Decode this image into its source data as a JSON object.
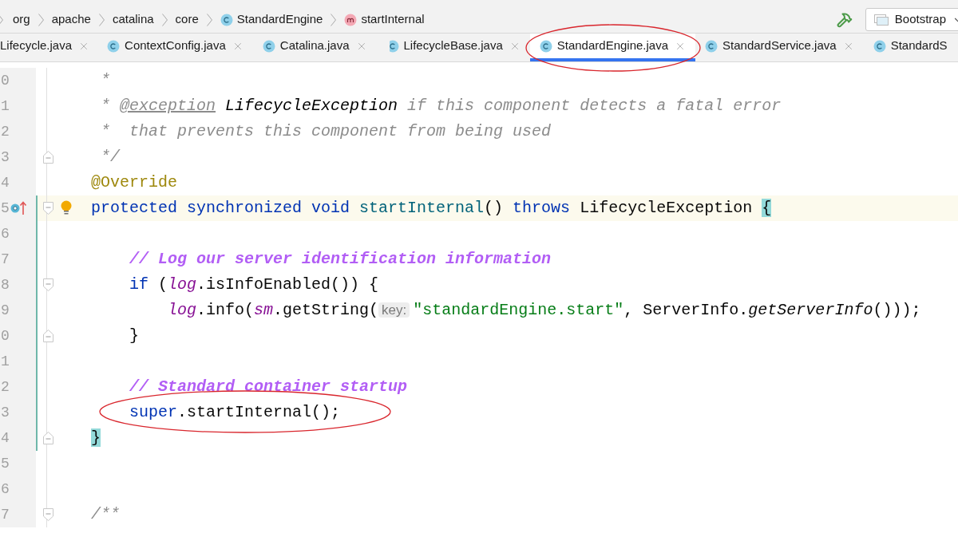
{
  "breadcrumb": {
    "items": [
      {
        "label": "org",
        "kind": "package"
      },
      {
        "label": "apache",
        "kind": "package"
      },
      {
        "label": "catalina",
        "kind": "package"
      },
      {
        "label": "core",
        "kind": "package"
      },
      {
        "label": "StandardEngine",
        "kind": "class"
      },
      {
        "label": "startInternal",
        "kind": "method"
      }
    ],
    "run_config": {
      "label": "Bootstrap"
    }
  },
  "tabs": [
    {
      "label": "Lifecycle.java",
      "kind": "none",
      "selected": false,
      "closable": true
    },
    {
      "label": "ContextConfig.java",
      "kind": "class",
      "selected": false,
      "closable": true
    },
    {
      "label": "Catalina.java",
      "kind": "class",
      "selected": false,
      "closable": true
    },
    {
      "label": "LifecycleBase.java",
      "kind": "abstract",
      "selected": false,
      "closable": true
    },
    {
      "label": "StandardEngine.java",
      "kind": "class",
      "selected": true,
      "closable": true
    },
    {
      "label": "StandardService.java",
      "kind": "class",
      "selected": false,
      "closable": true
    },
    {
      "label": "StandardS",
      "kind": "class",
      "selected": false,
      "closable": false
    }
  ],
  "editor": {
    "lines": [
      {
        "number": "0",
        "current": false,
        "modified": false,
        "intention": false,
        "segments": [
          {
            "text": " *",
            "kind": "doc"
          }
        ]
      },
      {
        "number": "1",
        "current": false,
        "modified": false,
        "intention": false,
        "segments": [
          {
            "text": " * ",
            "kind": "doc"
          },
          {
            "text": "@exception",
            "kind": "doc-tag"
          },
          {
            "text": " LifecycleException",
            "kind": "doc-ref"
          },
          {
            "text": " if this component detects a fatal error",
            "kind": "doc"
          }
        ]
      },
      {
        "number": "2",
        "current": false,
        "modified": false,
        "intention": false,
        "segments": [
          {
            "text": " *  that prevents this component from being used",
            "kind": "doc"
          }
        ]
      },
      {
        "number": "3",
        "current": false,
        "modified": false,
        "intention": false,
        "fold": {
          "kind": "end"
        },
        "segments": [
          {
            "text": " */",
            "kind": "doc"
          }
        ]
      },
      {
        "number": "4",
        "current": false,
        "modified": false,
        "intention": false,
        "segments": [
          {
            "text": "@Override",
            "kind": "annotation"
          }
        ]
      },
      {
        "number": "5",
        "current": true,
        "modified": true,
        "intention": true,
        "gutter_marker": {
          "kind": "override"
        },
        "fold": {
          "kind": "start"
        },
        "segments": [
          {
            "text": "protected synchronized void ",
            "kind": "keyword"
          },
          {
            "text": "startInternal",
            "kind": "method-decl"
          },
          {
            "text": "() ",
            "kind": "plain"
          },
          {
            "text": "throws ",
            "kind": "keyword"
          },
          {
            "text": "LifecycleException ",
            "kind": "plain"
          },
          {
            "text": "{",
            "kind": "matched-brace"
          }
        ]
      },
      {
        "number": "6",
        "current": false,
        "modified": true,
        "intention": false
      },
      {
        "number": "7",
        "current": false,
        "modified": true,
        "intention": false,
        "segments": [
          {
            "text": "    // Log our server identification information",
            "kind": "todo-comment"
          }
        ]
      },
      {
        "number": "8",
        "current": false,
        "modified": true,
        "intention": false,
        "fold": {
          "kind": "start"
        },
        "segments": [
          {
            "text": "    if ",
            "kind": "keyword"
          },
          {
            "text": "(",
            "kind": "plain"
          },
          {
            "text": "log",
            "kind": "field"
          },
          {
            "text": ".isInfoEnabled()) {",
            "kind": "plain"
          }
        ]
      },
      {
        "number": "9",
        "current": false,
        "modified": true,
        "intention": false,
        "segments": [
          {
            "text": "        log",
            "kind": "field"
          },
          {
            "text": ".info(",
            "kind": "plain"
          },
          {
            "text": "sm",
            "kind": "field"
          },
          {
            "text": ".getString(",
            "kind": "plain"
          },
          {
            "text": "key:",
            "kind": "hint"
          },
          {
            "text": "\"standardEngine.start\"",
            "kind": "string"
          },
          {
            "text": ", ServerInfo.",
            "kind": "plain"
          },
          {
            "text": "getServerInfo",
            "kind": "static-call"
          },
          {
            "text": "()));",
            "kind": "plain"
          }
        ]
      },
      {
        "number": "0",
        "current": false,
        "modified": true,
        "intention": false,
        "fold": {
          "kind": "end"
        },
        "segments": [
          {
            "text": "    }",
            "kind": "plain"
          }
        ]
      },
      {
        "number": "1",
        "current": false,
        "modified": true,
        "intention": false
      },
      {
        "number": "2",
        "current": false,
        "modified": true,
        "intention": false,
        "segments": [
          {
            "text": "    // Standard container startup",
            "kind": "todo-comment"
          }
        ]
      },
      {
        "number": "3",
        "current": false,
        "modified": true,
        "intention": false,
        "segments": [
          {
            "text": "    super",
            "kind": "keyword"
          },
          {
            "text": ".startInternal();",
            "kind": "plain"
          }
        ]
      },
      {
        "number": "4",
        "current": false,
        "modified": true,
        "intention": false,
        "fold": {
          "kind": "end"
        },
        "segments": [
          {
            "text": "}",
            "kind": "matched-brace"
          }
        ]
      },
      {
        "number": "5",
        "current": false,
        "modified": false,
        "intention": false
      },
      {
        "number": "6",
        "current": false,
        "modified": false,
        "intention": false
      },
      {
        "number": "7",
        "current": false,
        "modified": false,
        "intention": false,
        "fold": {
          "kind": "start"
        },
        "segments": [
          {
            "text": "/**",
            "kind": "doc"
          }
        ]
      }
    ]
  }
}
